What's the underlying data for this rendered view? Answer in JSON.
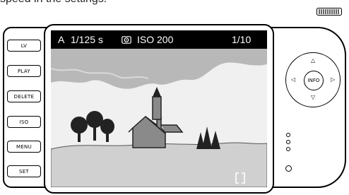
{
  "top_text": "speed in the settings.",
  "buttons": {
    "lv": "LV",
    "play": "PLAY",
    "delete": "DELETE",
    "iso": "ISO",
    "menu": "MENU",
    "set": "SET"
  },
  "screen": {
    "mode": "A",
    "shutter": "1/125 s",
    "metering_icon": "metering-icon",
    "iso": "ISO 200",
    "counter": "1/10"
  },
  "pad": {
    "center_label": "INFO",
    "up": "△",
    "down": "▽",
    "left": "◁",
    "right": "▷"
  },
  "colors": {
    "screen_bg": "#000000",
    "sky_light": "#f0f0f0",
    "sky_mid": "#b8b8b8",
    "ground": "#d0d0d0",
    "house": "#8a8a8a",
    "trees": "#222222"
  }
}
